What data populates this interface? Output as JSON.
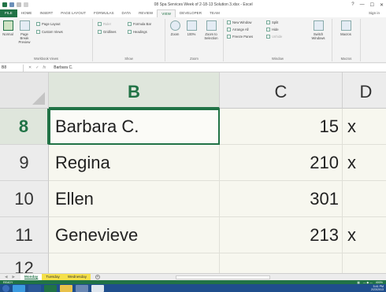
{
  "window": {
    "title": "08 Spa Services Week of 2-18-13 Solution 3.xlsx - Excel",
    "help": "?",
    "minimize": "—",
    "maximize": "☐",
    "close": "✕"
  },
  "tabs": [
    {
      "label": "FILE"
    },
    {
      "label": "HOME"
    },
    {
      "label": "INSERT"
    },
    {
      "label": "PAGE LAYOUT"
    },
    {
      "label": "FORMULAS"
    },
    {
      "label": "DATA"
    },
    {
      "label": "REVIEW"
    },
    {
      "label": "VIEW"
    },
    {
      "label": "DEVELOPER"
    },
    {
      "label": "TEAM"
    }
  ],
  "signin": "Sign in",
  "ribbon": {
    "workbook_views": {
      "label": "Workbook Views",
      "normal": "Normal",
      "page_break_preview": "Page Break Preview",
      "page_layout": "Page Layout",
      "custom_views": "Custom Views"
    },
    "show": {
      "label": "Show",
      "ruler": "Ruler",
      "formula_bar": "Formula Bar",
      "gridlines": "Gridlines",
      "headings": "Headings"
    },
    "zoom": {
      "label": "Zoom",
      "zoom": "Zoom",
      "zoom100": "100%",
      "zoom_to_selection": "Zoom to Selection"
    },
    "window": {
      "label": "Window",
      "new_window": "New Window",
      "arrange_all": "Arrange All",
      "freeze_panes": "Freeze Panes",
      "split": "Split",
      "hide": "Hide",
      "unhide": "Unhide",
      "switch_windows": "Switch Windows"
    },
    "macros": {
      "label": "Macros",
      "macros": "Macros"
    }
  },
  "formula_bar": {
    "name_box": "B8",
    "cancel": "✕",
    "enter": "✓",
    "fx": "fx",
    "content": "Barbara C."
  },
  "columns": [
    "B",
    "C",
    "D"
  ],
  "rows": [
    {
      "num": "8",
      "b": "Barbara C.",
      "c": "15",
      "d": "x"
    },
    {
      "num": "9",
      "b": "Regina",
      "c": "210",
      "d": "x"
    },
    {
      "num": "10",
      "b": "Ellen",
      "c": "301",
      "d": ""
    },
    {
      "num": "11",
      "b": "Genevieve",
      "c": "213",
      "d": "x"
    },
    {
      "num": "12",
      "b": "",
      "c": "",
      "d": ""
    }
  ],
  "sheets": [
    {
      "label": "Monday"
    },
    {
      "label": "Tuesday"
    },
    {
      "label": "Wednesday"
    }
  ],
  "add_sheet": "+",
  "status": {
    "ready": "READY",
    "zoom": "400%"
  },
  "tray": {
    "time": "5:41 PM",
    "date": "2/23/2013"
  },
  "colors": {
    "excel_green": "#217346",
    "taskbar_blue": "#1f4e8c",
    "sheet_tab_yellow": "#f5e04a"
  }
}
